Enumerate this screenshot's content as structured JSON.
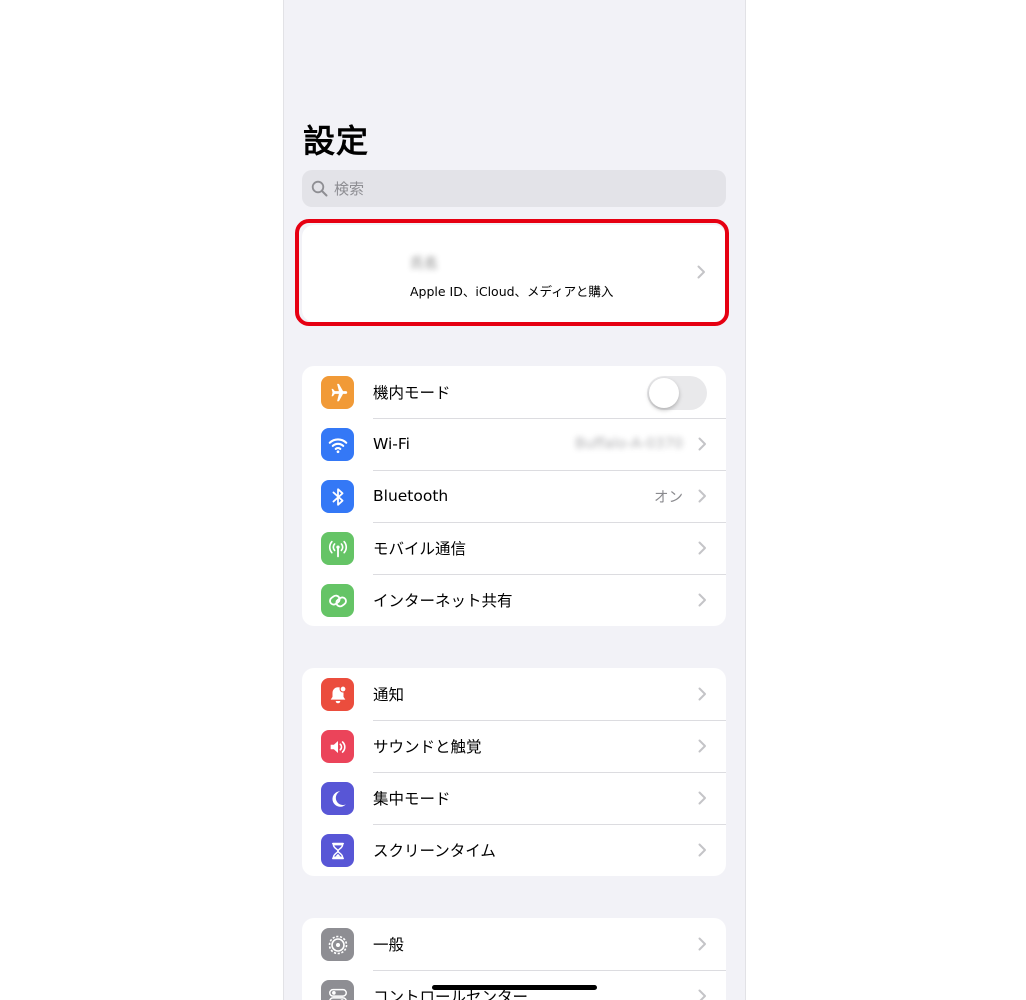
{
  "header": {
    "title": "設定"
  },
  "search": {
    "placeholder": "検索",
    "icon": "search-icon"
  },
  "account": {
    "name": "氏名",
    "subtitle": "Apple ID、iCloud、メディアと購入",
    "highlight_color": "#e60012"
  },
  "groups": [
    {
      "items": [
        {
          "label": "機内モード",
          "icon": "airplane-icon",
          "color": "#f19a37",
          "control": "toggle",
          "toggle_on": false
        },
        {
          "label": "Wi-Fi",
          "icon": "wifi-icon",
          "color": "#3478f6",
          "value": "Buffalo-A-0370",
          "value_blurred": true
        },
        {
          "label": "Bluetooth",
          "icon": "bluetooth-icon",
          "color": "#3478f6",
          "value": "オン"
        },
        {
          "label": "モバイル通信",
          "icon": "antenna-icon",
          "color": "#65c466"
        },
        {
          "label": "インターネット共有",
          "icon": "chain-link-icon",
          "color": "#65c466"
        }
      ]
    },
    {
      "items": [
        {
          "label": "通知",
          "icon": "bell-icon",
          "color": "#eb4d3d"
        },
        {
          "label": "サウンドと触覚",
          "icon": "speaker-icon",
          "color": "#eb445a"
        },
        {
          "label": "集中モード",
          "icon": "moon-icon",
          "color": "#5856d6"
        },
        {
          "label": "スクリーンタイム",
          "icon": "hourglass-icon",
          "color": "#5856d6"
        }
      ]
    },
    {
      "items": [
        {
          "label": "一般",
          "icon": "gear-icon",
          "color": "#8e8e93"
        },
        {
          "label": "コントロールセンター",
          "icon": "switches-icon",
          "color": "#8e8e93"
        }
      ]
    }
  ]
}
